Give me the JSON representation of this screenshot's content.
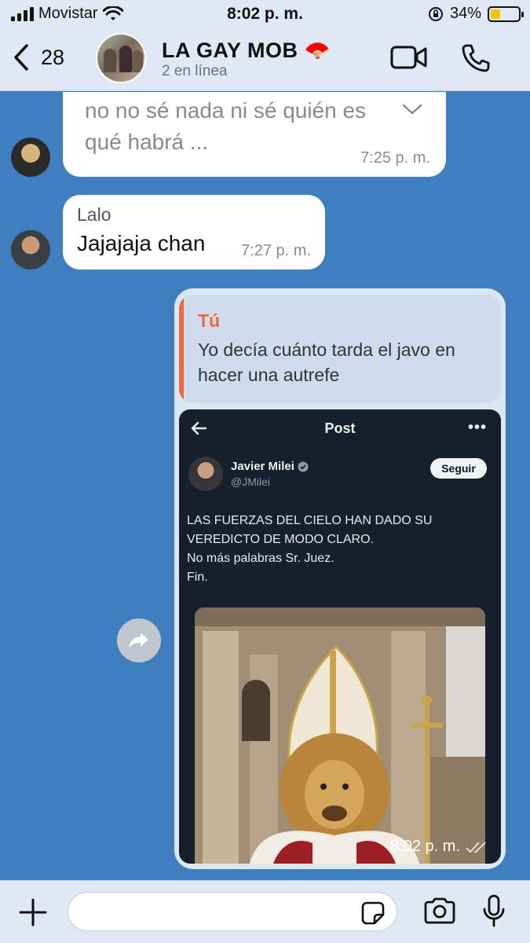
{
  "status_bar": {
    "carrier": "Movistar",
    "time": "8:02 p. m.",
    "battery": "34%",
    "battery_level": 0.34
  },
  "header": {
    "back_count": "28",
    "title": "LA GAY MOB 🪭",
    "subtitle": "2 en línea",
    "icons": [
      "video-call-icon",
      "phone-icon"
    ]
  },
  "messages": {
    "m1": {
      "line1": "no no sé nada ni sé quién es",
      "line2": "qué habrá ...",
      "time": "7:25 p. m."
    },
    "m2": {
      "sender": "Lalo",
      "text": "Jajajaja chan",
      "time": "7:27 p. m."
    },
    "m3": {
      "reply_sender": "Tú",
      "reply_line1": "Yo decía cuánto tarda el javo en",
      "reply_line2": "hacer una autrefe",
      "time": "8:02 p. m.",
      "tweet": {
        "screen_title": "Post",
        "author": "Javier Milei",
        "handle": "@JMilei",
        "follow_label": "Seguir",
        "lines": [
          "LAS FUERZAS DEL CIELO HAN DADO SU",
          "VEREDICTO DE MODO CLARO.",
          "No más palabras Sr. Juez.",
          "Fin."
        ]
      }
    }
  },
  "composer": {
    "placeholder": ""
  },
  "colors": {
    "chat_background": "#3f7fc0",
    "reply_accent": "#ea6a3a",
    "bar_background": "#dfe8f3"
  }
}
